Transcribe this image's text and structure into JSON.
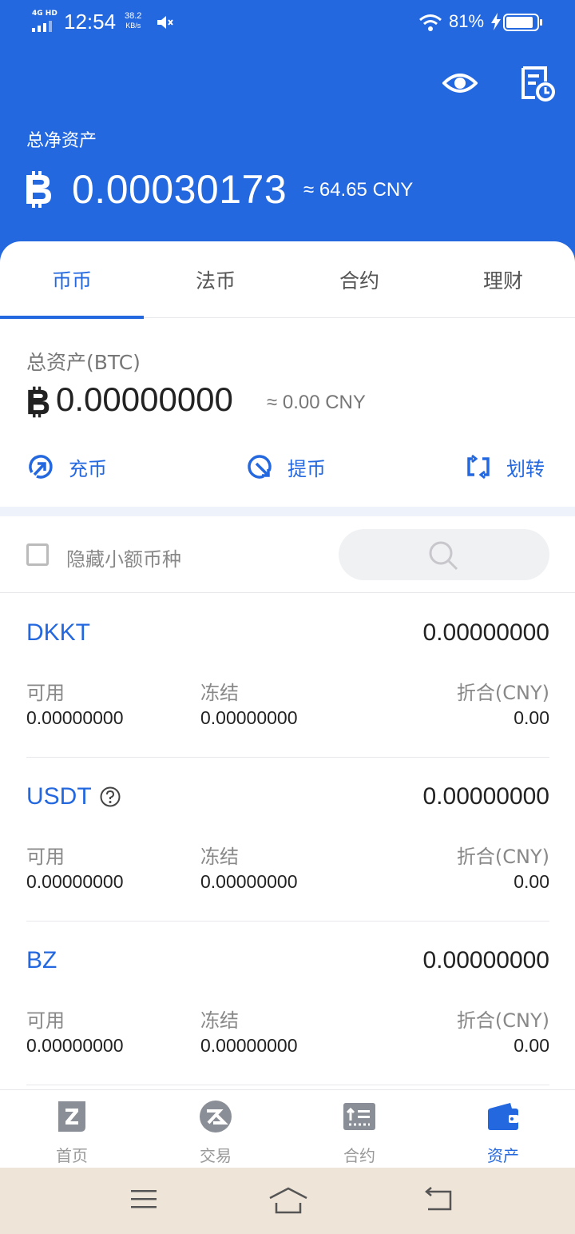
{
  "status_bar": {
    "network": "4G HD",
    "time": "12:54",
    "speed_value": "38.2",
    "speed_unit": "KB/s",
    "battery_pct": "81%"
  },
  "header": {
    "net_assets_label": "总净资产",
    "net_assets_btc": "0.00030173",
    "net_assets_cny": "≈ 64.65 CNY",
    "icons": [
      "eye-icon",
      "record-icon",
      "bitcoin-icon"
    ]
  },
  "tabs": [
    {
      "label": "币币",
      "active": true
    },
    {
      "label": "法币",
      "active": false
    },
    {
      "label": "合约",
      "active": false
    },
    {
      "label": "理财",
      "active": false
    }
  ],
  "account": {
    "total_label": "总资产(BTC)",
    "total_btc": "0.00000000",
    "total_cny": "≈ 0.00 CNY"
  },
  "actions": {
    "deposit": "充币",
    "withdraw": "提币",
    "transfer": "划转"
  },
  "filter": {
    "hide_small_label": "隐藏小额币种",
    "hide_small_checked": false,
    "search_placeholder": ""
  },
  "columns": {
    "available": "可用",
    "frozen": "冻结",
    "cny_value": "折合(CNY)"
  },
  "coins": [
    {
      "name": "DKKT",
      "total": "0.00000000",
      "available": "0.00000000",
      "frozen": "0.00000000",
      "cny": "0.00",
      "help": false
    },
    {
      "name": "USDT",
      "total": "0.00000000",
      "available": "0.00000000",
      "frozen": "0.00000000",
      "cny": "0.00",
      "help": true
    },
    {
      "name": "BZ",
      "total": "0.00000000",
      "available": "0.00000000",
      "frozen": "0.00000000",
      "cny": "0.00",
      "help": false
    }
  ],
  "bottom_nav": [
    {
      "label": "首页",
      "icon": "home-icon",
      "active": false
    },
    {
      "label": "交易",
      "icon": "trade-icon",
      "active": false
    },
    {
      "label": "合约",
      "icon": "contract-icon",
      "active": false
    },
    {
      "label": "资产",
      "icon": "wallet-icon",
      "active": true
    }
  ],
  "colors": {
    "primary": "#2468e0",
    "system_nav_bg": "#efe4d8"
  }
}
